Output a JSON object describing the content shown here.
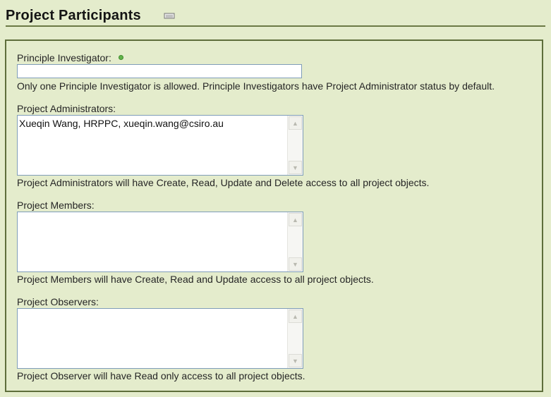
{
  "header": {
    "title": "Project Participants",
    "icon": "collapse-icon"
  },
  "form": {
    "principle_investigator": {
      "label": "Principle Investigator:",
      "value": "",
      "help": "Only one Principle Investigator is allowed. Principle Investigators have Project Administrator status by default."
    },
    "administrators": {
      "label": "Project Administrators:",
      "value": "Xueqin Wang, HRPPC, xueqin.wang@csiro.au",
      "help": "Project Administrators will have Create, Read, Update and Delete access to all project objects."
    },
    "members": {
      "label": "Project Members:",
      "value": "",
      "help": "Project Members will have Create, Read and Update access to all project objects."
    },
    "observers": {
      "label": "Project Observers:",
      "value": "",
      "help": "Project Observer will have Read only access to all project objects."
    }
  },
  "scrollbar": {
    "up_icon": "▲",
    "down_icon": "▼"
  },
  "colors": {
    "background": "#e4eccc",
    "border": "#5e6e3b",
    "required": "#62b44a"
  }
}
